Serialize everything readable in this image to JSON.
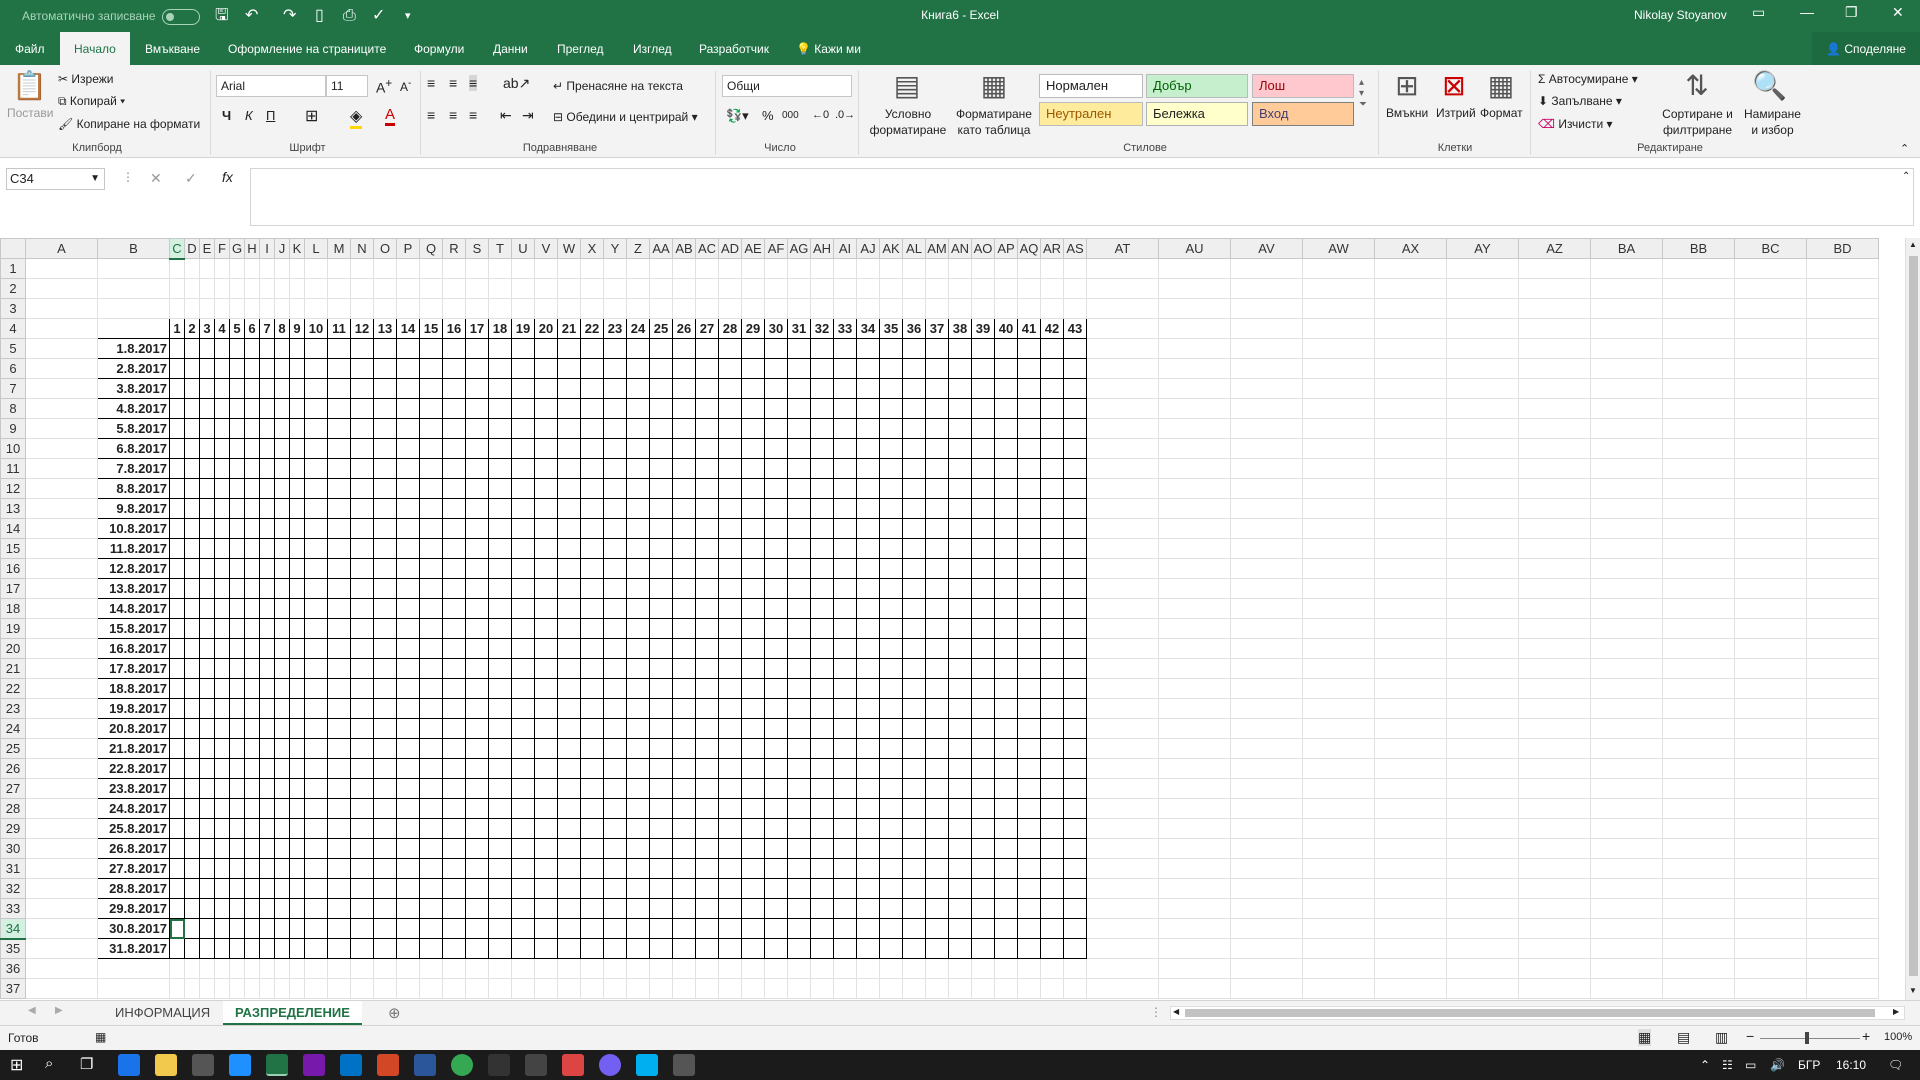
{
  "app": {
    "autosave_label": "Автоматично записване",
    "title": "Книга6  -  Excel",
    "user": "Nikolay Stoyanov",
    "share": "Споделяне"
  },
  "tabs": [
    "Файл",
    "Начало",
    "Вмъкване",
    "Оформление на страниците",
    "Формули",
    "Данни",
    "Преглед",
    "Изглед",
    "Разработчик",
    "Кажи ми"
  ],
  "active_tab": "Начало",
  "ribbon": {
    "clipboard": {
      "label": "Клипборд",
      "paste": "Постави",
      "cut": "Изрежи",
      "copy": "Копирай",
      "format_painter": "Копиране на формати"
    },
    "font": {
      "label": "Шрифт",
      "font_name": "Arial",
      "font_size": "11",
      "bold": "Ч",
      "italic": "К",
      "underline": "П"
    },
    "alignment": {
      "label": "Подравняване",
      "wrap": "Пренасяне на текста",
      "merge": "Обедини и центрирай"
    },
    "number": {
      "label": "Число",
      "format": "Общи"
    },
    "styles": {
      "label": "Стилове",
      "conditional": "Условно форматиране",
      "format_table": "Форматиране като таблица",
      "normal": "Нормален",
      "good": "Добър",
      "bad": "Лош",
      "neutral": "Неутрален",
      "note": "Бележка",
      "input": "Вход"
    },
    "cells": {
      "label": "Клетки",
      "insert": "Вмъкни",
      "delete": "Изтрий",
      "format": "Формат"
    },
    "editing": {
      "label": "Редактиране",
      "autosum": "Автосумиране",
      "fill": "Запълване",
      "clear": "Изчисти",
      "sort": "Сортиране и филтриране",
      "find": "Намиране и избор"
    }
  },
  "formula_bar": {
    "name_box": "C34",
    "fx": "fx",
    "value": ""
  },
  "sheet": {
    "columns": [
      "A",
      "B",
      "C",
      "D",
      "E",
      "F",
      "G",
      "H",
      "I",
      "J",
      "K",
      "L",
      "M",
      "N",
      "O",
      "P",
      "Q",
      "R",
      "S",
      "T",
      "U",
      "V",
      "W",
      "X",
      "Y",
      "Z",
      "AA",
      "AB",
      "AC",
      "AD",
      "AE",
      "AF",
      "AG",
      "AH",
      "AI",
      "AJ",
      "AK",
      "AL",
      "AM",
      "AN",
      "AO",
      "AP",
      "AQ",
      "AR",
      "AS",
      "AT",
      "AU",
      "AV",
      "AW",
      "AX",
      "AY",
      "AZ",
      "BA",
      "BB",
      "BC",
      "BD"
    ],
    "header_numbers": [
      "1",
      "2",
      "3",
      "4",
      "5",
      "6",
      "7",
      "8",
      "9",
      "10",
      "11",
      "12",
      "13",
      "14",
      "15",
      "16",
      "17",
      "18",
      "19",
      "20",
      "21",
      "22",
      "23",
      "24",
      "25",
      "26",
      "27",
      "28",
      "29",
      "30",
      "31",
      "32",
      "33",
      "34",
      "35",
      "36",
      "37",
      "38",
      "39",
      "40",
      "41",
      "42",
      "43"
    ],
    "dates": [
      "1.8.2017",
      "2.8.2017",
      "3.8.2017",
      "4.8.2017",
      "5.8.2017",
      "6.8.2017",
      "7.8.2017",
      "8.8.2017",
      "9.8.2017",
      "10.8.2017",
      "11.8.2017",
      "12.8.2017",
      "13.8.2017",
      "14.8.2017",
      "15.8.2017",
      "16.8.2017",
      "17.8.2017",
      "18.8.2017",
      "19.8.2017",
      "20.8.2017",
      "21.8.2017",
      "22.8.2017",
      "23.8.2017",
      "24.8.2017",
      "25.8.2017",
      "26.8.2017",
      "27.8.2017",
      "28.8.2017",
      "29.8.2017",
      "30.8.2017",
      "31.8.2017"
    ],
    "active_cell": "C34"
  },
  "sheet_tabs": [
    "ИНФОРМАЦИЯ",
    "РАЗПРЕДЕЛЕНИЕ"
  ],
  "active_sheet": "РАЗПРЕДЕЛЕНИЕ",
  "status": {
    "ready": "Готов",
    "zoom": "100%"
  },
  "taskbar": {
    "lang": "БГР",
    "time": "16:10"
  },
  "colors": {
    "accent": "#217346"
  }
}
